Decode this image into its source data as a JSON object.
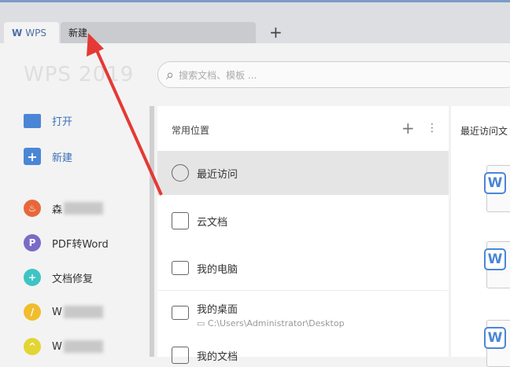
{
  "tabs": [
    {
      "label": "WPS",
      "icon": "wps-logo-icon"
    },
    {
      "label": "新建"
    }
  ],
  "new_tab": "+",
  "watermark": "WPS 2019",
  "search": {
    "placeholder": "搜索文档、模板 ..."
  },
  "sidebar": {
    "items": [
      {
        "label": "打开",
        "icon": "folder-icon"
      },
      {
        "label": "新建",
        "icon": "plus-icon"
      },
      {
        "label": "森",
        "icon": "app-orange-icon",
        "color": "#e8673a"
      },
      {
        "label": "PDF转Word",
        "icon": "pdf-icon",
        "color": "#7b6bc7"
      },
      {
        "label": "文档修复",
        "icon": "repair-icon",
        "color": "#3ec4c4"
      },
      {
        "label": "W",
        "icon": "feather-icon",
        "color": "#f0be2c"
      },
      {
        "label": "W",
        "icon": "graduation-icon",
        "color": "#e3d533"
      }
    ]
  },
  "locations": {
    "title": "常用位置",
    "add": "+",
    "more": "⋮",
    "items": [
      {
        "label": "最近访问",
        "icon": "clock-icon"
      },
      {
        "label": "云文档",
        "icon": "cube-icon"
      },
      {
        "label": "我的电脑",
        "icon": "monitor-icon"
      },
      {
        "label": "我的桌面",
        "path": "C:\\Users\\Administrator\\Desktop",
        "icon": "desktop-icon"
      },
      {
        "label": "我的文档",
        "icon": "document-folder-icon"
      }
    ]
  },
  "recent": {
    "title": "最近访问文",
    "doc_icon": "W"
  }
}
